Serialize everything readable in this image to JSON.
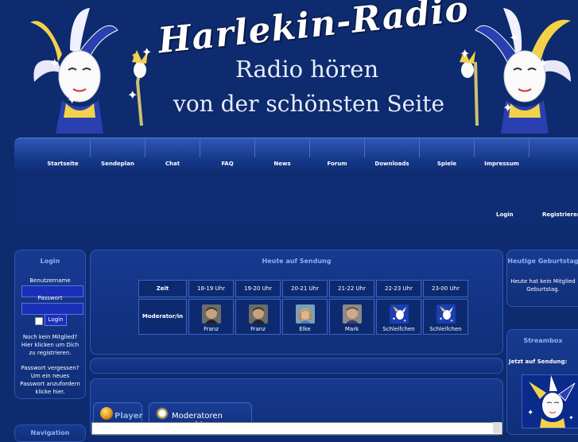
{
  "banner": {
    "title": "Harlekin-Radio",
    "line1": "Radio hören",
    "line2": "von der schönsten Seite"
  },
  "nav": {
    "items": [
      "Startseite",
      "Sendeplan",
      "Chat",
      "FAQ",
      "News",
      "Forum",
      "Downloads",
      "Spiele",
      "Impressum"
    ]
  },
  "subnav": {
    "login": "Login",
    "register": "Registrieren"
  },
  "login": {
    "title": "Login",
    "username_label": "Benutzername",
    "password_label": "Passwort",
    "button": "Login",
    "register_text": "Noch kein Mitglied? Hier klicken um Dich zu registrieren.",
    "forgot_text": "Passwort vergessen? Um ein neues Passwort anzufordern klicke hier."
  },
  "heute": {
    "title": "Heute auf Sendung",
    "time_label": "Zeit",
    "mod_label": "Moderator/in",
    "slots": [
      "18-19 Uhr",
      "19-20 Uhr",
      "20-21 Uhr",
      "21-22 Uhr",
      "22-23 Uhr",
      "23-00 Uhr"
    ],
    "mods": [
      "Franz",
      "Franz",
      "Elke",
      "Mark",
      "Schleifchen",
      "Schleifchen"
    ]
  },
  "tabs": {
    "player": "Player",
    "moderatoren": "Moderatoren gesucht"
  },
  "birthday": {
    "title": "Heutige Geburtstag",
    "text": "Heute hat kein Mitglied Geburtstag."
  },
  "stream": {
    "title": "Streambox",
    "now_label": "Jetzt auf Sendung:"
  },
  "navleft": {
    "title": "Navigation"
  },
  "colors": {
    "background": "#0d2b6e",
    "panel": "#173a90",
    "panel_title": "#8fb0ee",
    "input": "#1a2fb8"
  }
}
